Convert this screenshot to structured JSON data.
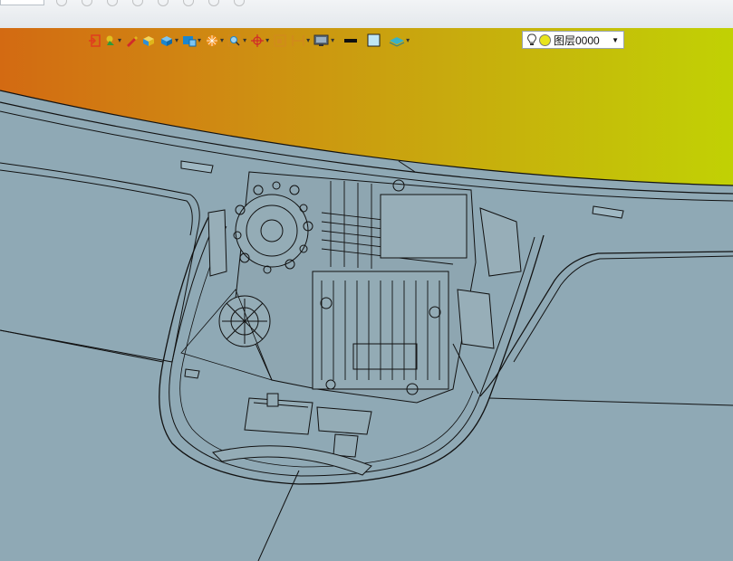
{
  "window": {
    "title_stub": ""
  },
  "toolbar": {
    "items": [
      {
        "icon": "exit-sketch-icon",
        "color": "#e03c1e"
      },
      {
        "icon": "snap-icon",
        "color": "#2e9a3a"
      },
      {
        "icon": "pencil-icon",
        "color": "#d12a2a"
      },
      {
        "icon": "solid-box-icon",
        "color": "#e0b51a"
      },
      {
        "icon": "view-cube-icon",
        "color": "#1a86d0"
      },
      {
        "icon": "display-mode-icon",
        "color": "#1a86d0"
      },
      {
        "icon": "render-sphere-icon",
        "color": "#f0901a"
      },
      {
        "icon": "zoom-fit-icon",
        "color": "#d28a1c"
      },
      {
        "icon": "axis-origin-icon",
        "color": "#d12a2a"
      },
      {
        "icon": "section-view-icon",
        "color": "#d28a1c"
      },
      {
        "icon": "dimension-icon",
        "color": "#d28a1c"
      },
      {
        "icon": "monitor-icon",
        "color": "#5a6a78"
      },
      {
        "icon": "line-weight-icon",
        "color": "#111111"
      },
      {
        "icon": "color-swatch-icon",
        "color": "#bfe6f5"
      },
      {
        "icon": "layers-icon",
        "color": "#38b2c8"
      }
    ],
    "layer_selector": {
      "value": "图层0000",
      "bulb_icon": "lightbulb-icon",
      "state_icon": "layer-visible-icon",
      "state_color": "#e8e41c"
    }
  },
  "viewport": {
    "background_left": "#d36a12",
    "background_right": "#c1d104",
    "model_surface_color": "#8fa9b5",
    "edge_color": "#111111"
  }
}
